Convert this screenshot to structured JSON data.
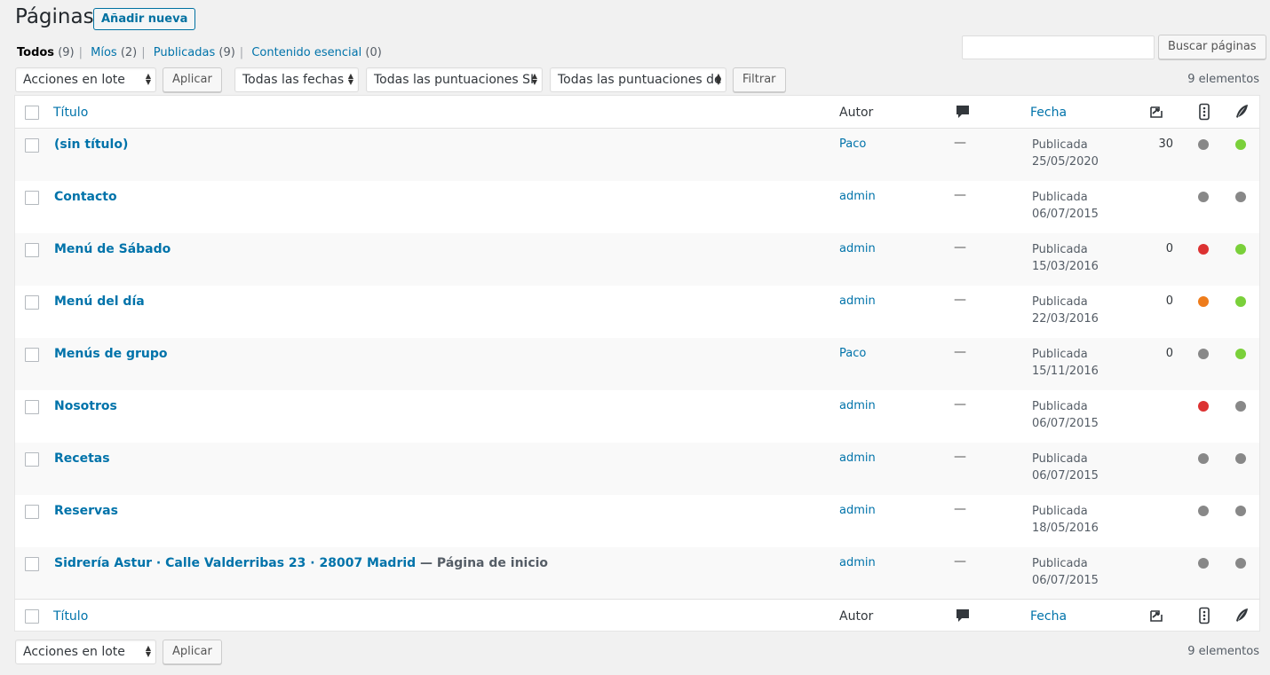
{
  "header": {
    "title": "Páginas",
    "add_new": "Añadir nueva"
  },
  "views": [
    {
      "label": "Todos",
      "count": "(9)"
    },
    {
      "label": "Míos",
      "count": "(2)"
    },
    {
      "label": "Publicadas",
      "count": "(9)"
    },
    {
      "label": "Contenido esencial",
      "count": "(0)"
    }
  ],
  "search": {
    "button": "Buscar páginas",
    "value": ""
  },
  "filters": {
    "bulk_actions": "Acciones en lote",
    "apply": "Aplicar",
    "dates": "Todas las fechas",
    "seo_scores": "Todas las puntuaciones SI",
    "readability_scores": "Todas las puntuaciones de",
    "filter": "Filtrar",
    "items_count": "9 elementos"
  },
  "columns": {
    "title": "Título",
    "author": "Autor",
    "date": "Fecha"
  },
  "colors": {
    "green": "#7ad03a",
    "gray": "#888888",
    "red": "#dc3232",
    "orange": "#ee7c1b",
    "link": "#0073aa"
  },
  "rows": [
    {
      "title": "(sin título)",
      "suffix": "",
      "author": "Paco",
      "comments": "—",
      "status": "Publicada",
      "date": "25/05/2020",
      "links": "30",
      "seo": "gray",
      "readability": "green"
    },
    {
      "title": "Contacto",
      "suffix": "",
      "author": "admin",
      "comments": "—",
      "status": "Publicada",
      "date": "06/07/2015",
      "links": "",
      "seo": "gray",
      "readability": "gray"
    },
    {
      "title": "Menú de Sábado",
      "suffix": "",
      "author": "admin",
      "comments": "—",
      "status": "Publicada",
      "date": "15/03/2016",
      "links": "0",
      "seo": "red",
      "readability": "green"
    },
    {
      "title": "Menú del día",
      "suffix": "",
      "author": "admin",
      "comments": "—",
      "status": "Publicada",
      "date": "22/03/2016",
      "links": "0",
      "seo": "orange",
      "readability": "green"
    },
    {
      "title": "Menús de grupo",
      "suffix": "",
      "author": "Paco",
      "comments": "—",
      "status": "Publicada",
      "date": "15/11/2016",
      "links": "0",
      "seo": "gray",
      "readability": "green"
    },
    {
      "title": "Nosotros",
      "suffix": "",
      "author": "admin",
      "comments": "—",
      "status": "Publicada",
      "date": "06/07/2015",
      "links": "",
      "seo": "red",
      "readability": "gray"
    },
    {
      "title": "Recetas",
      "suffix": "",
      "author": "admin",
      "comments": "—",
      "status": "Publicada",
      "date": "06/07/2015",
      "links": "",
      "seo": "gray",
      "readability": "gray"
    },
    {
      "title": "Reservas",
      "suffix": "",
      "author": "admin",
      "comments": "—",
      "status": "Publicada",
      "date": "18/05/2016",
      "links": "",
      "seo": "gray",
      "readability": "gray"
    },
    {
      "title": "Sidrería Astur · Calle Valderribas 23 · 28007 Madrid",
      "suffix": " — Página de inicio",
      "author": "admin",
      "comments": "—",
      "status": "Publicada",
      "date": "06/07/2015",
      "links": "",
      "seo": "gray",
      "readability": "gray"
    }
  ]
}
